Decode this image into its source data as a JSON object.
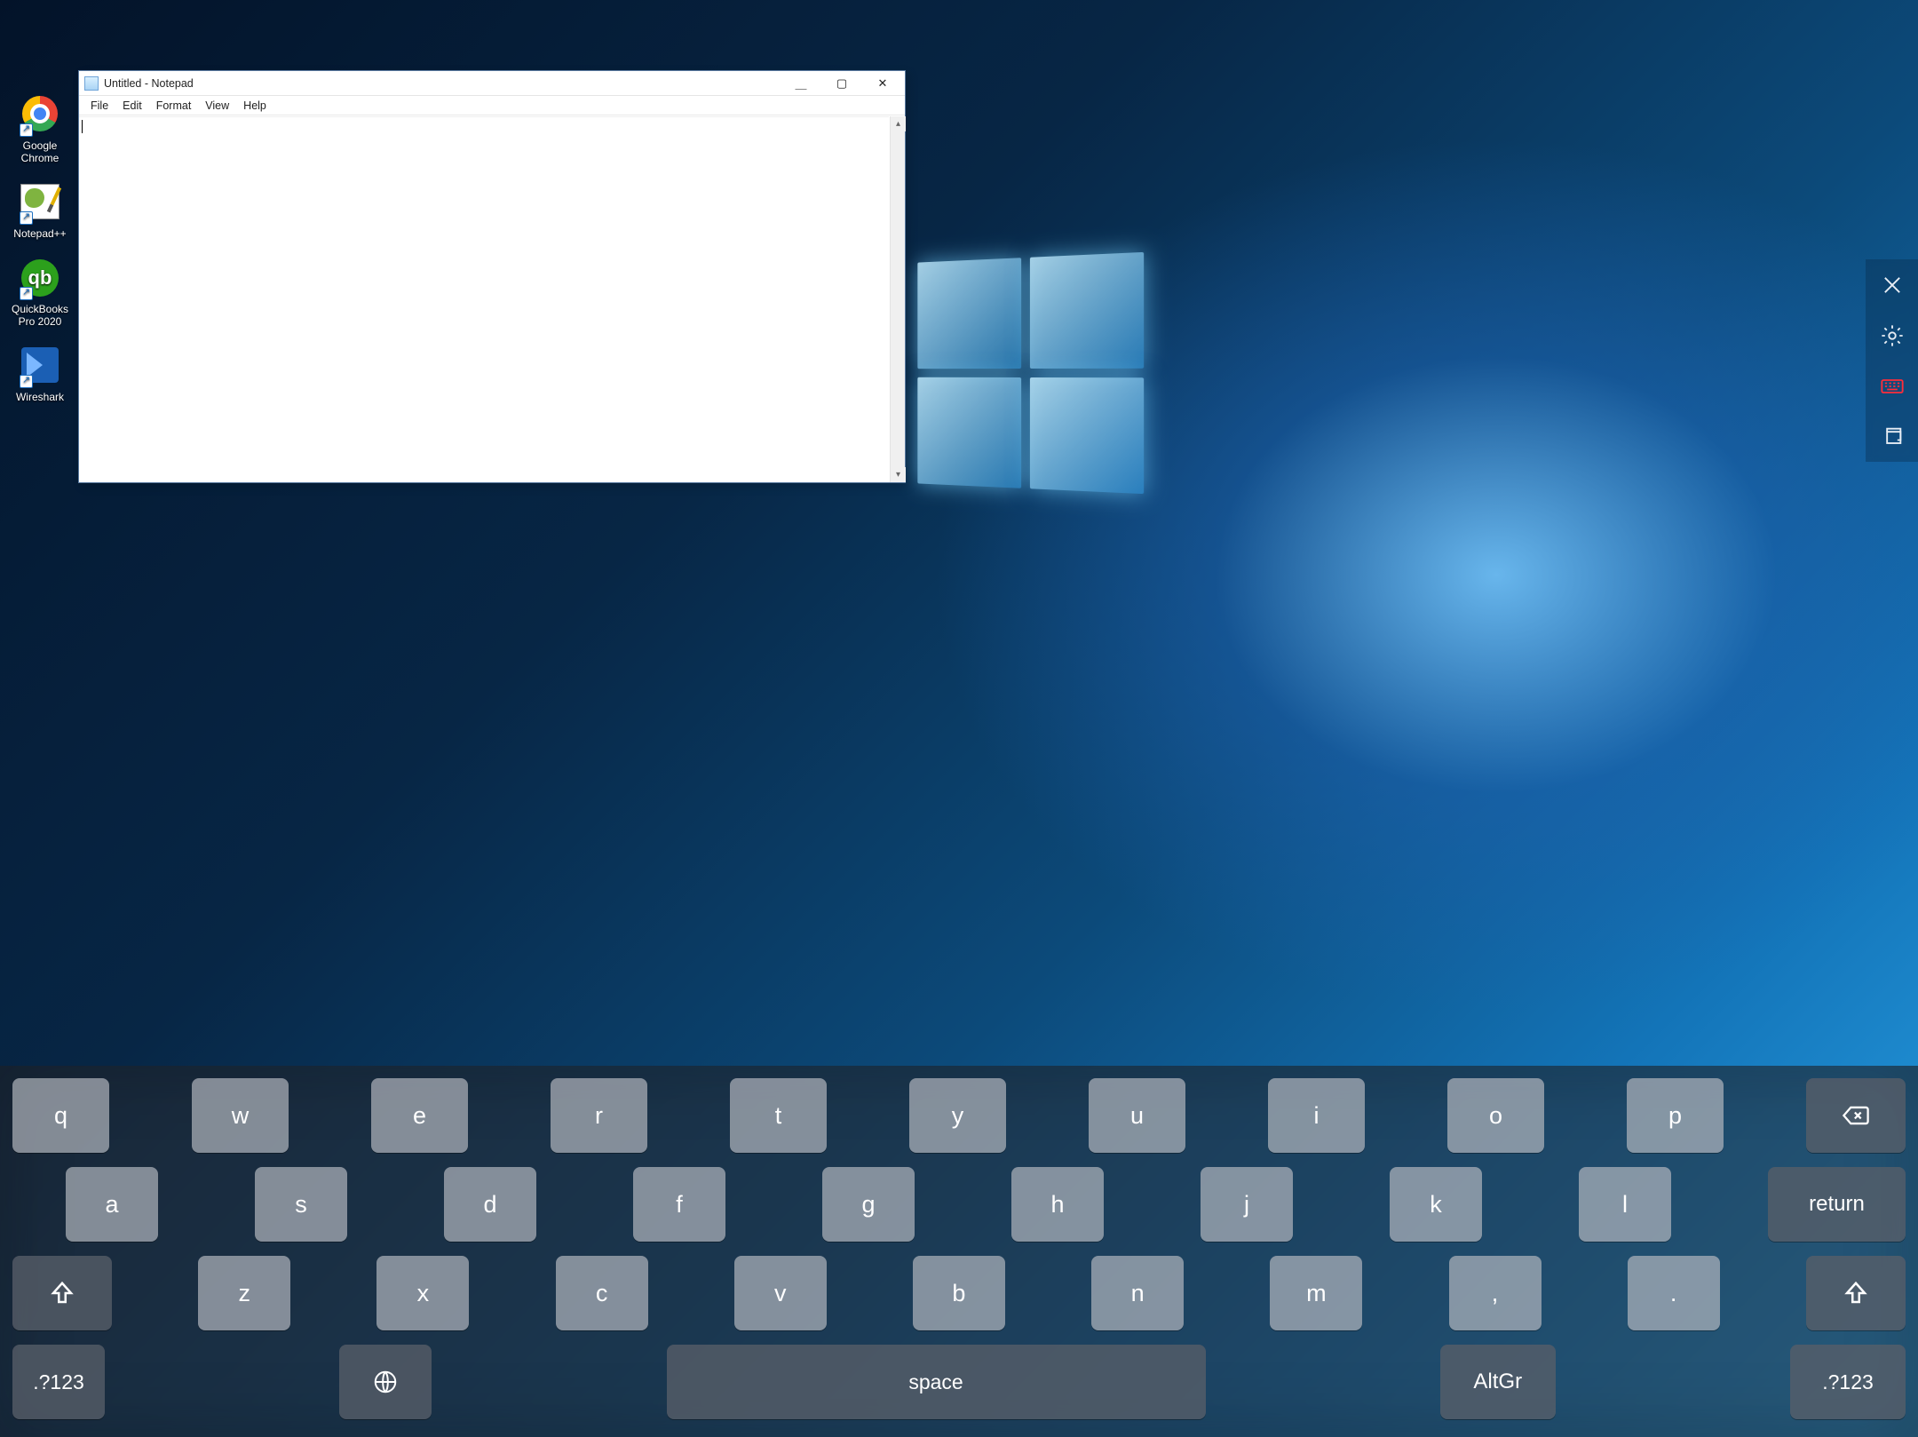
{
  "desktop_icons": [
    {
      "label": "Google\nChrome",
      "name": "desktop-icon-chrome"
    },
    {
      "label": "Notepad++",
      "name": "desktop-icon-notepadpp"
    },
    {
      "label": "QuickBooks\nPro 2020",
      "name": "desktop-icon-quickbooks"
    },
    {
      "label": "Wireshark",
      "name": "desktop-icon-wireshark"
    }
  ],
  "notepad": {
    "title": "Untitled - Notepad",
    "menu": [
      "File",
      "Edit",
      "Format",
      "View",
      "Help"
    ],
    "content": ""
  },
  "side_panel": {
    "items": [
      "close",
      "settings",
      "keyboard",
      "multi-window"
    ]
  },
  "keyboard": {
    "row1": [
      "q",
      "w",
      "e",
      "r",
      "t",
      "y",
      "u",
      "i",
      "o",
      "p"
    ],
    "row2": [
      "a",
      "s",
      "d",
      "f",
      "g",
      "h",
      "j",
      "k",
      "l"
    ],
    "row3": [
      "z",
      "x",
      "c",
      "v",
      "b",
      "n",
      "m",
      ",",
      "."
    ],
    "numLabel": ".?123",
    "spaceLabel": "space",
    "altgrLabel": "AltGr",
    "returnLabel": "return"
  }
}
